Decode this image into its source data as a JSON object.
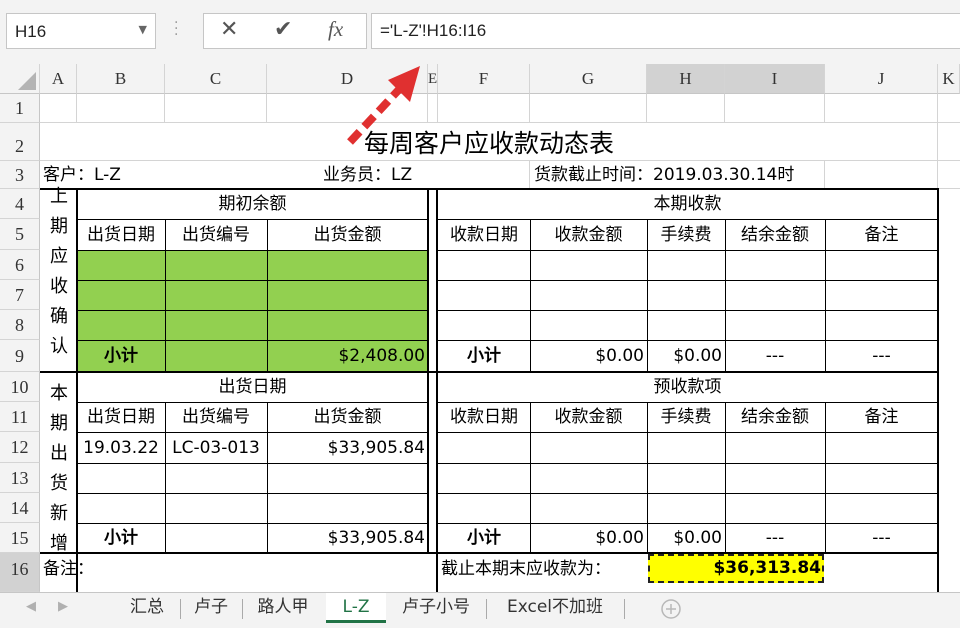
{
  "formula_bar": {
    "name_box": "H16",
    "cancel_glyph": "✕",
    "enter_glyph": "✔",
    "fx_glyph": "fx",
    "formula": "='L-Z'!H16:I16"
  },
  "columns": [
    "A",
    "B",
    "C",
    "D",
    "E",
    "F",
    "G",
    "H",
    "I",
    "J",
    "K"
  ],
  "rows": [
    "1",
    "2",
    "3",
    "4",
    "5",
    "6",
    "7",
    "8",
    "9",
    "10",
    "11",
    "12",
    "13",
    "14",
    "15",
    "16"
  ],
  "sheet": {
    "title": "每周客户应收款动态表",
    "customer": "客户：L-Z",
    "salesperson": "业务员：LZ",
    "cutoff": "货款截止时间：2019.03.30.14时",
    "side_prev": "上期应收确认余额",
    "side_new": "本期出货新增",
    "opening_header": "期初余额",
    "current_receipts_header": "本期收款",
    "shipment_header": "出货日期",
    "advance_header": "预收款项",
    "ship_cols": [
      "出货日期",
      "出货编号",
      "出货金额"
    ],
    "recv_cols": [
      "收款日期",
      "收款金额",
      "手续费",
      "结余金额",
      "备注"
    ],
    "subtotal": "小计",
    "opening_subtotal": "$2,408.00",
    "recv_amount_sub": "$0.00",
    "fee_sub": "$0.00",
    "balance_dash": "---",
    "note_dash": "---",
    "shipment_row": {
      "date": "19.03.22",
      "no": "LC-03-013",
      "amount": "$33,905.84"
    },
    "shipment_subtotal": "$33,905.84",
    "notes_label": "备注：",
    "closing_label": "截止本期末应收款为：",
    "closing_value": "$36,313.84"
  },
  "tabs": [
    "汇总",
    "卢子",
    "路人甲",
    "L-Z",
    "卢子小号",
    "Excel不加班"
  ],
  "active_tab": "L-Z",
  "colors": {
    "green_fill": "#92d050",
    "yellow_fill": "#ffff00",
    "arrow": "#e03030",
    "active_tab": "#217346"
  }
}
